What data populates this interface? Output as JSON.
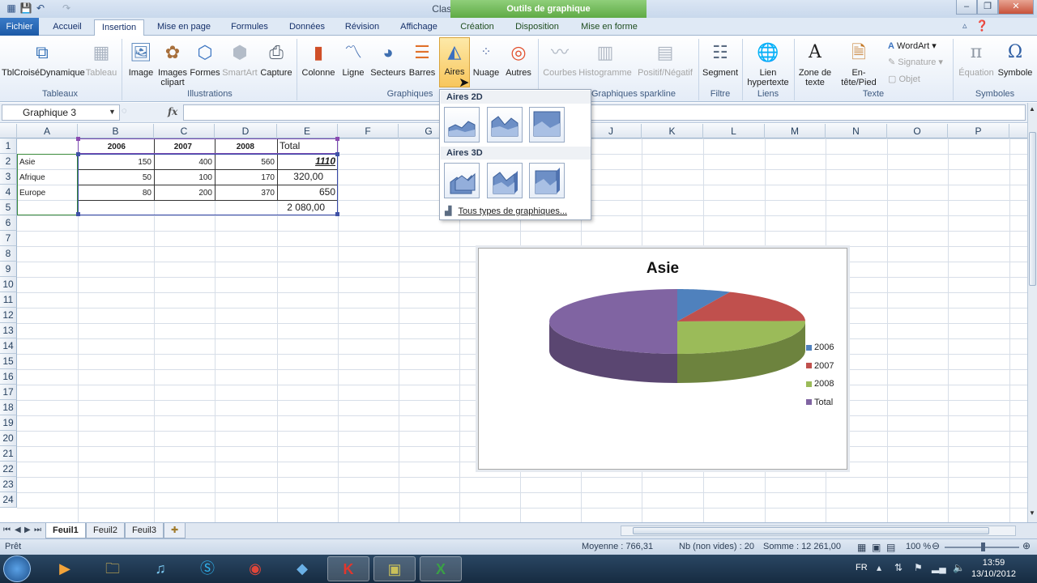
{
  "window": {
    "title": "Classeur1 - Microsoft Excel (Évaluation)",
    "chart_tools_label": "Outils de graphique",
    "buttons": [
      "–",
      "❐",
      "✕"
    ]
  },
  "tabs": {
    "file": "Fichier",
    "items": [
      "Accueil",
      "Insertion",
      "Mise en page",
      "Formules",
      "Données",
      "Révision",
      "Affichage"
    ],
    "chart_items": [
      "Création",
      "Disposition",
      "Mise en forme"
    ],
    "active": "Insertion"
  },
  "ribbon": {
    "tableaux": {
      "label": "Tableaux",
      "pivot": "TblCroiséDynamique",
      "table": "Tableau"
    },
    "illustrations": {
      "label": "Illustrations",
      "image": "Image",
      "clipart": "Images clipart",
      "formes": "Formes",
      "smartart": "SmartArt",
      "capture": "Capture"
    },
    "graphiques": {
      "label": "Graphiques",
      "colonne": "Colonne",
      "ligne": "Ligne",
      "secteurs": "Secteurs",
      "barres": "Barres",
      "aires": "Aires",
      "nuage": "Nuage",
      "autres": "Autres"
    },
    "sparkline": {
      "label": "Graphiques sparkline",
      "courbes": "Courbes",
      "histogramme": "Histogramme",
      "positif": "Positif/Négatif"
    },
    "filtre": {
      "label": "Filtre",
      "segment": "Segment"
    },
    "liens": {
      "label": "Liens",
      "lien": "Lien hypertexte"
    },
    "texte": {
      "label": "Texte",
      "zone": "Zone de texte",
      "entete": "En-tête/Pied",
      "wordart": "WordArt",
      "signature": "Signature",
      "objet": "Objet"
    },
    "symboles": {
      "label": "Symboles",
      "equation": "Équation",
      "symbole": "Symbole"
    }
  },
  "formula_bar": {
    "name_box": "Graphique 3",
    "fx": "fx",
    "formula": ""
  },
  "columns": [
    "A",
    "B",
    "C",
    "D",
    "E",
    "F",
    "G",
    "H",
    "I",
    "J",
    "K",
    "L",
    "M",
    "N",
    "O",
    "P"
  ],
  "rows": [
    "1",
    "2",
    "3",
    "4",
    "5",
    "6",
    "7",
    "8",
    "9",
    "10",
    "11",
    "12",
    "13",
    "14",
    "15",
    "16",
    "17",
    "18",
    "19",
    "20",
    "21",
    "22",
    "23",
    "24"
  ],
  "sheet": {
    "header": {
      "b": "2006",
      "c": "2007",
      "d": "2008",
      "e": "Total"
    },
    "r2": {
      "a": "Asie",
      "b": "150",
      "c": "400",
      "d": "560",
      "e": "1110"
    },
    "r3": {
      "a": "Afrique",
      "b": "50",
      "c": "100",
      "d": "170",
      "e": "320,00"
    },
    "r4": {
      "a": "Europe",
      "b": "80",
      "c": "200",
      "d": "370",
      "e": "650"
    },
    "r5": {
      "e": "2 080,00"
    }
  },
  "dropdown": {
    "section_2d": "Aires 2D",
    "section_3d": "Aires 3D",
    "all_types": "Tous types de graphiques..."
  },
  "chart_data": {
    "type": "pie",
    "title": "Asie",
    "categories": [
      "2006",
      "2007",
      "2008",
      "Total"
    ],
    "values": [
      150,
      400,
      560,
      1110
    ],
    "colors": [
      "#4f81bd",
      "#c0504d",
      "#9bbb59",
      "#8064a2"
    ],
    "legend_position": "right"
  },
  "sheet_tabs": [
    "Feuil1",
    "Feuil2",
    "Feuil3"
  ],
  "status": {
    "ready": "Prêt",
    "average": "Moyenne : 766,31",
    "count": "Nb (non vides) : 20",
    "sum": "Somme : 12 261,00",
    "zoom": "100 %"
  },
  "taskbar": {
    "lang": "FR",
    "time": "13:59",
    "date": "13/10/2012"
  }
}
